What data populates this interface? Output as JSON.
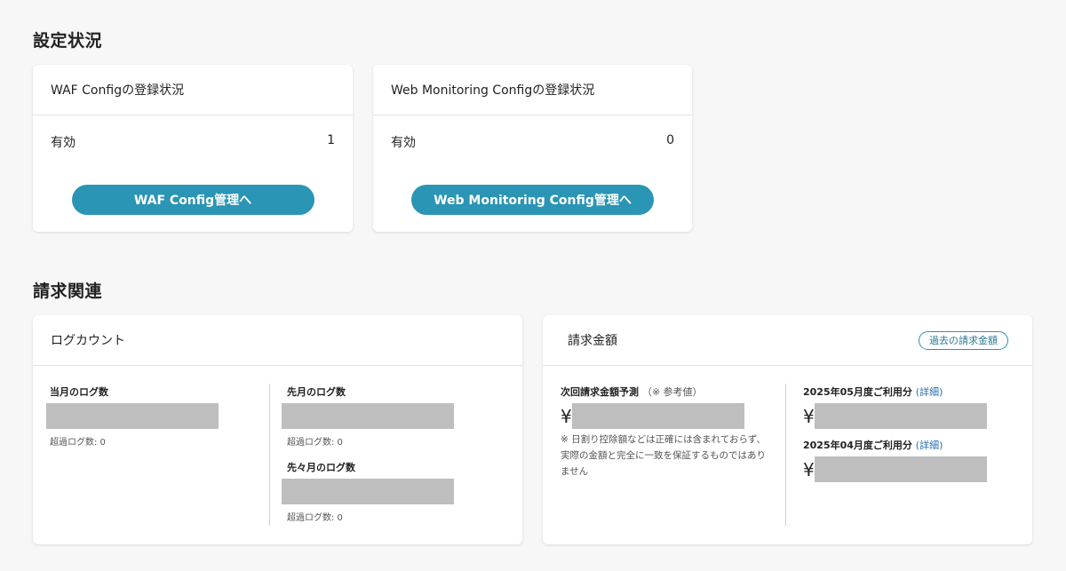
{
  "settings": {
    "section_title": "設定状況",
    "waf": {
      "title": "WAF Configの登録状況",
      "status_label": "有効",
      "status_value": "1",
      "button_label": "WAF Config管理へ"
    },
    "web": {
      "title": "Web Monitoring Configの登録状況",
      "status_label": "有効",
      "status_value": "0",
      "button_label": "Web Monitoring Config管理へ"
    }
  },
  "billing": {
    "section_title": "請求関連",
    "log_count": {
      "title": "ログカウント",
      "current_label": "当月のログ数",
      "current_excess": "超過ログ数: 0",
      "previous_label": "先月のログ数",
      "previous_excess": "超過ログ数: 0",
      "two_months_label": "先々月のログ数",
      "two_months_excess": "超過ログ数: 0"
    },
    "amount": {
      "title": "請求金額",
      "past_button_label": "過去の請求金額",
      "next_label": "次回請求金額予測",
      "next_label_note": "（※ 参考値）",
      "yen_symbol": "¥",
      "note": "※ 日割り控除額などは正確には含まれておらず、実際の金額と完全に一致を保証するものではありません",
      "may_label": "2025年05月度ご利用分",
      "apr_label": "2025年04月度ご利用分",
      "detail_label": "(詳細)"
    }
  },
  "colors": {
    "accent": "#2a95b4",
    "redacted": "#bebebe"
  }
}
